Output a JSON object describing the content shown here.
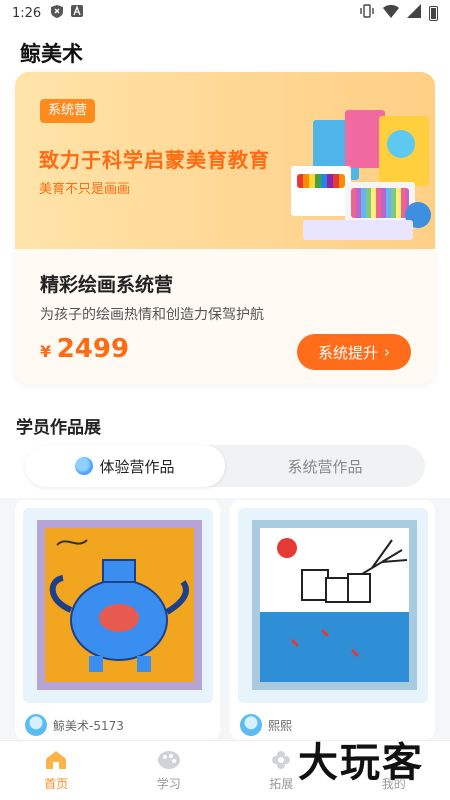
{
  "status_bar": {
    "time": "1:26"
  },
  "header": {
    "title": "鲸美术"
  },
  "banner": {
    "tag": "系统营",
    "slogan": "致力于科学启蒙美育教育",
    "sub_slogan": "美育不只是画画"
  },
  "course": {
    "title": "精彩绘画系统营",
    "description": "为孩子的绘画热情和创造力保驾护航",
    "currency": "¥",
    "price": "2499",
    "cta_label": "系统提升",
    "cta_arrow": "›"
  },
  "works": {
    "section_title": "学员作品展",
    "tabs": [
      {
        "label": "体验营作品",
        "active": true
      },
      {
        "label": "系统营作品",
        "active": false
      }
    ],
    "items": [
      {
        "author": "鲸美术-5173"
      },
      {
        "author": "熙熙"
      }
    ]
  },
  "bottom_nav": [
    {
      "label": "首页",
      "icon": "home-icon",
      "active": true
    },
    {
      "label": "学习",
      "icon": "palette-icon",
      "active": false
    },
    {
      "label": "拓展",
      "icon": "flower-icon",
      "active": false
    },
    {
      "label": "我的",
      "icon": "user-icon",
      "active": false
    }
  ],
  "watermark": "大玩客",
  "colors": {
    "accent": "#ff6d1b",
    "tag": "#ff8b1f",
    "banner": "#ffd794"
  }
}
